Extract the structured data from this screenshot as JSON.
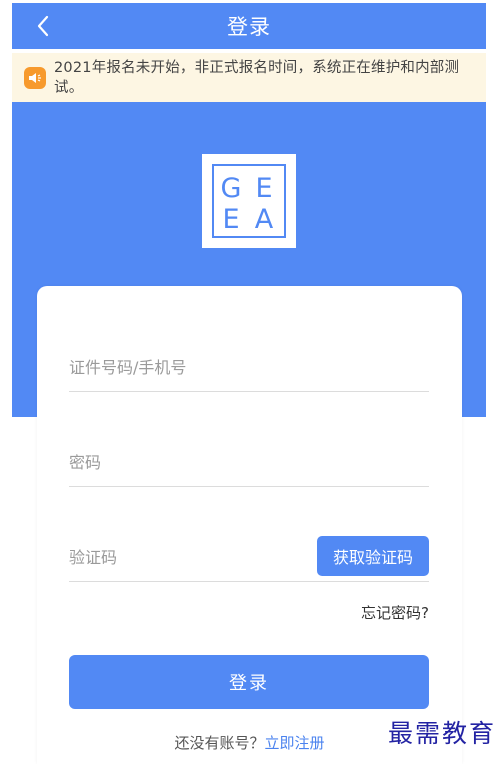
{
  "header": {
    "title": "登录",
    "back_icon": "chevron-left-icon"
  },
  "notice": {
    "icon": "speaker-icon",
    "text": "2021年报名未开始，非正式报名时间，系统正在维护和内部测试。"
  },
  "logo": {
    "top_left": "G",
    "top_right": "E",
    "bottom_left": "E",
    "bottom_right": "A"
  },
  "form": {
    "id_placeholder": "证件号码/手机号",
    "password_placeholder": "密码",
    "code_placeholder": "验证码",
    "get_code_label": "获取验证码",
    "forgot_label": "忘记密码?",
    "login_label": "登录",
    "no_account_text": "还没有账号？",
    "register_label": "立即注册"
  },
  "watermark": "最需教育",
  "colors": {
    "primary": "#5289f4",
    "notice_bg": "#fdf6e3",
    "notice_icon": "#f79a2d"
  }
}
